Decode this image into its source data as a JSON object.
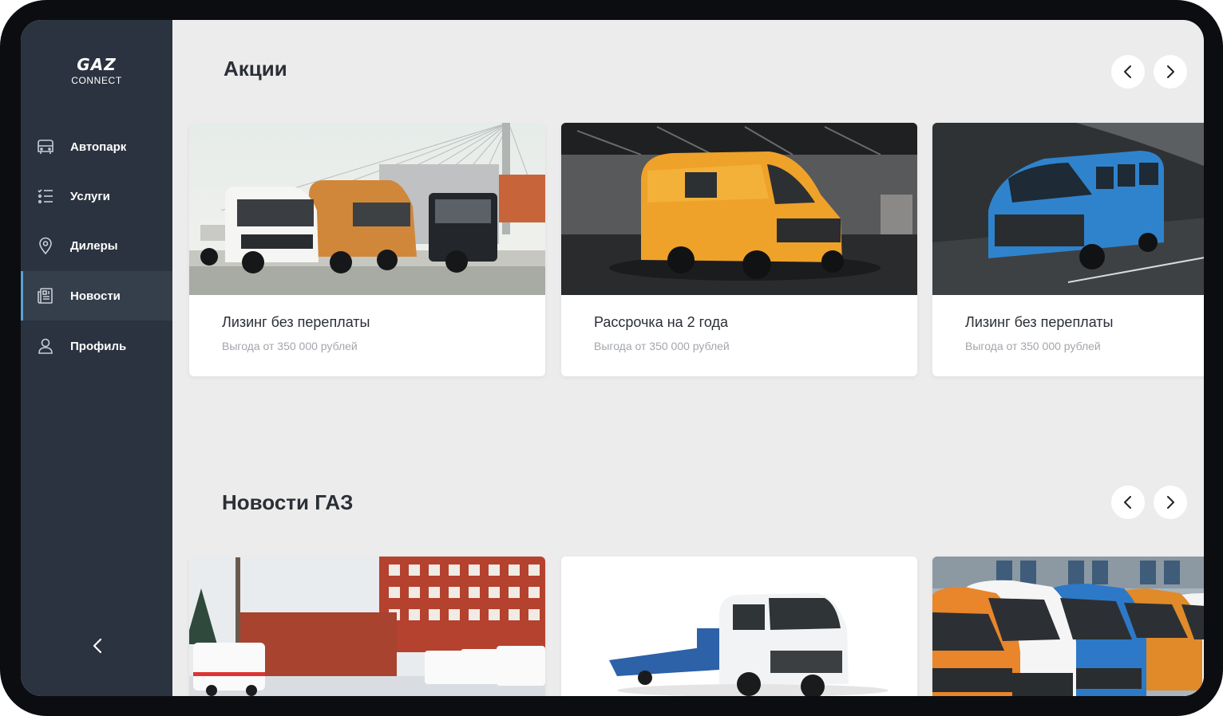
{
  "logo": {
    "main": "GAZ",
    "sub": "CONNECT"
  },
  "sidebar": {
    "items": [
      {
        "label": "Автопарк",
        "icon": "bus-icon"
      },
      {
        "label": "Услуги",
        "icon": "list-icon"
      },
      {
        "label": "Дилеры",
        "icon": "location-pin-icon"
      },
      {
        "label": "Новости",
        "icon": "newspaper-icon",
        "active": true
      },
      {
        "label": "Профиль",
        "icon": "user-icon"
      }
    ],
    "collapse_icon": "chevron-left-icon"
  },
  "promotions": {
    "title": "Акции",
    "cards": [
      {
        "title": "Лизинг без переплаты",
        "subtitle": "Выгода от 350 000 рублей",
        "image": "truck-lineup-bridge"
      },
      {
        "title": "Рассрочка на 2 года",
        "subtitle": "Выгода от 350 000 рублей",
        "image": "orange-van-warehouse"
      },
      {
        "title": "Лизинг без переплаты",
        "subtitle": "Выгода от 350 000 рублей",
        "image": "blue-minibus"
      }
    ]
  },
  "news": {
    "title": "Новости ГАЗ",
    "cards": [
      {
        "image": "ambulances-building"
      },
      {
        "image": "tow-truck"
      },
      {
        "image": "colorful-vans-row"
      }
    ]
  },
  "colors": {
    "sidebar": "#2b3340",
    "sidebar_active": "#353e4b",
    "accent": "#5aa0d6",
    "background": "#ececec"
  }
}
